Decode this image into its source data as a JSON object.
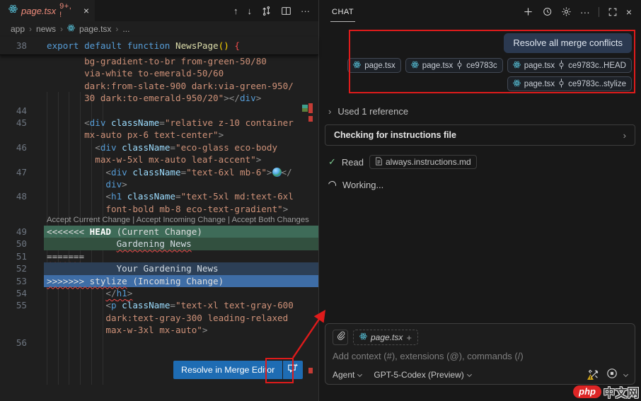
{
  "editor": {
    "tab": {
      "title": "page.tsx",
      "badge": "9+, !",
      "close_glyph": "×"
    },
    "tab_actions": {
      "prev": "↑",
      "next": "↓",
      "more": "···"
    },
    "breadcrumb": {
      "root": "app",
      "folder": "news",
      "file": "page.tsx",
      "tail": "...",
      "sep": "›"
    },
    "codelens": {
      "link1": "Accept Current Change",
      "link2": "Accept Incoming Change",
      "link3": "Accept Both Changes",
      "sep": " | "
    },
    "resolve_button": {
      "label": "Resolve in Merge Editor"
    },
    "code_lines": [
      {
        "n": "38",
        "c": "sticky",
        "t": [
          [
            "kw",
            "export default function "
          ],
          [
            "fn",
            "NewsPage"
          ],
          [
            "gold",
            "()"
          ],
          [
            "redb",
            " {"
          ]
        ]
      },
      {
        "t": [
          [
            "str",
            "       bg-gradient-to-br from-green-50/80"
          ]
        ]
      },
      {
        "t": [
          [
            "str",
            "       via-white to-emerald-50/60"
          ]
        ]
      },
      {
        "t": [
          [
            "str",
            "       dark:from-slate-900 dark:via-green-950/"
          ]
        ]
      },
      {
        "t": [
          [
            "str",
            "       30 dark:to-emerald-950/20\""
          ],
          [
            "pun",
            "></"
          ],
          [
            "tag",
            "div"
          ],
          [
            "pun",
            ">"
          ]
        ]
      },
      {
        "n": "44",
        "t": []
      },
      {
        "n": "45",
        "t": [
          [
            "pun",
            "       <"
          ],
          [
            "tag",
            "div"
          ],
          [
            "attr",
            " className"
          ],
          [
            "pun",
            "="
          ],
          [
            "str",
            "\"relative z-10 container"
          ]
        ]
      },
      {
        "t": [
          [
            "str",
            "       mx-auto px-6 text-center\""
          ],
          [
            "pun",
            ">"
          ]
        ]
      },
      {
        "n": "46",
        "t": [
          [
            "pun",
            "         <"
          ],
          [
            "tag",
            "div"
          ],
          [
            "attr",
            " className"
          ],
          [
            "pun",
            "="
          ],
          [
            "str",
            "\"eco-glass eco-body"
          ]
        ]
      },
      {
        "t": [
          [
            "str",
            "         max-w-5xl mx-auto leaf-accent\""
          ],
          [
            "pun",
            ">"
          ]
        ]
      },
      {
        "n": "47",
        "t": [
          [
            "pun",
            "           <"
          ],
          [
            "tag",
            "div"
          ],
          [
            "attr",
            " className"
          ],
          [
            "pun",
            "="
          ],
          [
            "str",
            "\"text-6xl mb-6\""
          ],
          [
            "pun",
            ">"
          ],
          [
            "globe",
            ""
          ],
          [
            "pun",
            "</"
          ]
        ]
      },
      {
        "t": [
          [
            "tag",
            "           div"
          ],
          [
            "pun",
            ">"
          ]
        ]
      },
      {
        "n": "48",
        "t": [
          [
            "pun",
            "           <"
          ],
          [
            "tag",
            "h1"
          ],
          [
            "attr",
            " className"
          ],
          [
            "pun",
            "="
          ],
          [
            "str",
            "\"text-5xl md:text-6xl"
          ]
        ]
      },
      {
        "t": [
          [
            "str",
            "           font-bold mb-8 eco-text-gradient\""
          ],
          [
            "pun",
            ">"
          ]
        ]
      },
      {
        "lens": true
      },
      {
        "n": "49",
        "bg": "cur-head",
        "t": [
          [
            "mk sq",
            "<<<<<<< "
          ],
          [
            "mkb sq",
            "HEAD"
          ],
          [
            "mk",
            " (Current Change)"
          ]
        ]
      },
      {
        "n": "50",
        "bg": "cur-body",
        "t": [
          [
            "txt",
            "             "
          ],
          [
            "txt sq",
            "Gardening News"
          ]
        ]
      },
      {
        "n": "51",
        "t": [
          [
            "eq sq",
            "======="
          ]
        ]
      },
      {
        "n": "52",
        "bg": "inc-body",
        "t": [
          [
            "txt",
            "             "
          ],
          [
            "txt",
            "Your Gardening News"
          ]
        ]
      },
      {
        "n": "53",
        "bg": "inc-head",
        "t": [
          [
            "mk sq",
            ">>>>>>> stylize"
          ],
          [
            "mk",
            " (Incoming Change)"
          ]
        ]
      },
      {
        "n": "54",
        "t": [
          [
            "pun",
            "           "
          ],
          [
            "pun sq",
            "</"
          ],
          [
            "tag sq",
            "h1"
          ],
          [
            "pun sq",
            ">"
          ]
        ]
      },
      {
        "n": "55",
        "t": [
          [
            "pun",
            "           <"
          ],
          [
            "tag",
            "p"
          ],
          [
            "attr",
            " className"
          ],
          [
            "pun",
            "="
          ],
          [
            "str",
            "\"text-xl text-gray-600"
          ]
        ]
      },
      {
        "t": [
          [
            "str",
            "           dark:text-gray-300 leading-relaxed"
          ]
        ]
      },
      {
        "t": [
          [
            "str",
            "           max-w-3xl mx-auto\""
          ],
          [
            "pun",
            ">"
          ]
        ]
      },
      {
        "n": "56",
        "t": []
      }
    ]
  },
  "chat": {
    "tab_label": "CHAT",
    "header_more": "···",
    "header_close": "×",
    "message": "Resolve all merge conflicts",
    "context_chips": [
      {
        "file": "page.tsx",
        "ref": ""
      },
      {
        "file": "page.tsx",
        "ref": "ce9783c"
      },
      {
        "file": "page.tsx",
        "ref": "ce9783c..HEAD"
      },
      {
        "file": "page.tsx",
        "ref": "ce9783c..stylize"
      }
    ],
    "chevron": "›",
    "used_reference": "Used 1 reference",
    "instructions_box": {
      "label": "Checking for instructions file"
    },
    "read_step": {
      "check": "✓",
      "label": "Read",
      "file": "always.instructions.md"
    },
    "working_label": "Working...",
    "input": {
      "context_chip": {
        "file": "page.tsx",
        "add": "+"
      },
      "placeholder": "Add context (#), extensions (@), commands (/)",
      "agent": "Agent",
      "model": "GPT-5-Codex (Preview)"
    }
  },
  "watermark": {
    "brand": "php",
    "site": "中文网"
  }
}
